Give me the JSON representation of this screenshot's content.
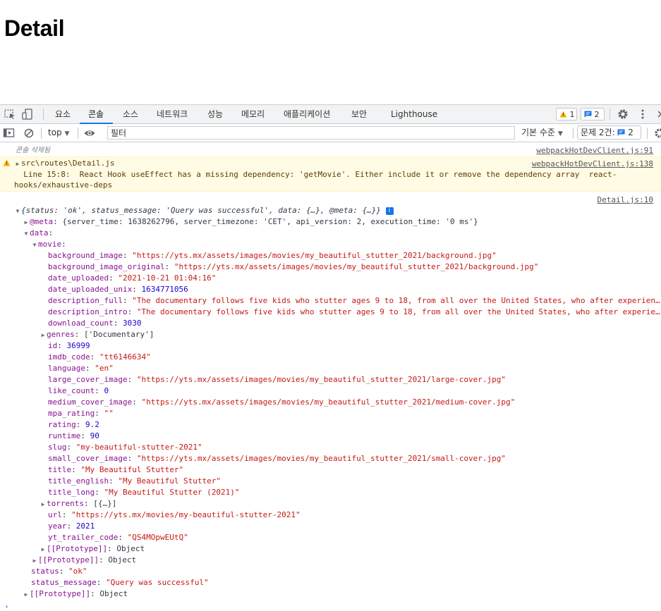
{
  "page": {
    "title": "Detail"
  },
  "devtools": {
    "tabs": [
      "요소",
      "콘솔",
      "소스",
      "네트워크",
      "성능",
      "메모리",
      "애플리케이션",
      "보안",
      "Lighthouse"
    ],
    "active_tab": "콘솔",
    "warnings_count": "1",
    "messages_count": "2",
    "filter": {
      "context": "top",
      "placeholder": "필터",
      "levels": "기본 수준",
      "issues_label": "문제 2건:",
      "issues_count": "2"
    }
  },
  "console": {
    "cleared_text": "콘솔 삭제됨",
    "cleared_source": "webpackHotDevClient.js:91",
    "warning": {
      "file": "src\\routes\\Detail.js",
      "source": "webpackHotDevClient.js:138",
      "line1": "  Line 15:8:  React Hook useEffect has a missing dependency: 'getMovie'. Either include it or remove the dependency array  react-",
      "line2": "hooks/exhaustive-deps"
    },
    "log_source": "Detail.js:10",
    "summary": "{status: 'ok', status_message: 'Query was successful', data: {…}, @meta: {…}}",
    "meta": {
      "key": "@meta",
      "value": "{server_time: 1638262796, server_timezone: 'CET', api_version: 2, execution_time: '0 ms'}"
    },
    "tree": [
      {
        "depth": 1,
        "arrow": "down",
        "key": "data",
        "value": "",
        "type": "plain"
      },
      {
        "depth": 2,
        "arrow": "down",
        "key": "movie",
        "value": "",
        "type": "plain"
      },
      {
        "depth": 3,
        "arrow": "",
        "key": "background_image",
        "value": "\"https://yts.mx/assets/images/movies/my_beautiful_stutter_2021/background.jpg\"",
        "type": "str"
      },
      {
        "depth": 3,
        "arrow": "",
        "key": "background_image_original",
        "value": "\"https://yts.mx/assets/images/movies/my_beautiful_stutter_2021/background.jpg\"",
        "type": "str"
      },
      {
        "depth": 3,
        "arrow": "",
        "key": "date_uploaded",
        "value": "\"2021-10-21 01:04:16\"",
        "type": "str"
      },
      {
        "depth": 3,
        "arrow": "",
        "key": "date_uploaded_unix",
        "value": "1634771056",
        "type": "num"
      },
      {
        "depth": 3,
        "arrow": "",
        "key": "description_full",
        "value": "\"The documentary follows five kids who stutter ages 9 to 18, from all over the United States, who after experien…",
        "type": "str"
      },
      {
        "depth": 3,
        "arrow": "",
        "key": "description_intro",
        "value": "\"The documentary follows five kids who stutter ages 9 to 18, from all over the United States, who after experie…",
        "type": "str"
      },
      {
        "depth": 3,
        "arrow": "",
        "key": "download_count",
        "value": "3030",
        "type": "num"
      },
      {
        "depth": 3,
        "arrow": "right",
        "key": "genres",
        "value": "['Documentary']",
        "type": "plain"
      },
      {
        "depth": 3,
        "arrow": "",
        "key": "id",
        "value": "36999",
        "type": "num"
      },
      {
        "depth": 3,
        "arrow": "",
        "key": "imdb_code",
        "value": "\"tt6146634\"",
        "type": "str"
      },
      {
        "depth": 3,
        "arrow": "",
        "key": "language",
        "value": "\"en\"",
        "type": "str"
      },
      {
        "depth": 3,
        "arrow": "",
        "key": "large_cover_image",
        "value": "\"https://yts.mx/assets/images/movies/my_beautiful_stutter_2021/large-cover.jpg\"",
        "type": "str"
      },
      {
        "depth": 3,
        "arrow": "",
        "key": "like_count",
        "value": "0",
        "type": "num"
      },
      {
        "depth": 3,
        "arrow": "",
        "key": "medium_cover_image",
        "value": "\"https://yts.mx/assets/images/movies/my_beautiful_stutter_2021/medium-cover.jpg\"",
        "type": "str"
      },
      {
        "depth": 3,
        "arrow": "",
        "key": "mpa_rating",
        "value": "\"\"",
        "type": "str"
      },
      {
        "depth": 3,
        "arrow": "",
        "key": "rating",
        "value": "9.2",
        "type": "num"
      },
      {
        "depth": 3,
        "arrow": "",
        "key": "runtime",
        "value": "90",
        "type": "num"
      },
      {
        "depth": 3,
        "arrow": "",
        "key": "slug",
        "value": "\"my-beautiful-stutter-2021\"",
        "type": "str"
      },
      {
        "depth": 3,
        "arrow": "",
        "key": "small_cover_image",
        "value": "\"https://yts.mx/assets/images/movies/my_beautiful_stutter_2021/small-cover.jpg\"",
        "type": "str"
      },
      {
        "depth": 3,
        "arrow": "",
        "key": "title",
        "value": "\"My Beautiful Stutter\"",
        "type": "str"
      },
      {
        "depth": 3,
        "arrow": "",
        "key": "title_english",
        "value": "\"My Beautiful Stutter\"",
        "type": "str"
      },
      {
        "depth": 3,
        "arrow": "",
        "key": "title_long",
        "value": "\"My Beautiful Stutter (2021)\"",
        "type": "str"
      },
      {
        "depth": 3,
        "arrow": "right",
        "key": "torrents",
        "value": "[{…}]",
        "type": "plain"
      },
      {
        "depth": 3,
        "arrow": "",
        "key": "url",
        "value": "\"https://yts.mx/movies/my-beautiful-stutter-2021\"",
        "type": "str"
      },
      {
        "depth": 3,
        "arrow": "",
        "key": "year",
        "value": "2021",
        "type": "num"
      },
      {
        "depth": 3,
        "arrow": "",
        "key": "yt_trailer_code",
        "value": "\"QS4MOpwEUtQ\"",
        "type": "str"
      },
      {
        "depth": 3,
        "arrow": "right",
        "key": "[[Prototype]]",
        "value": "Object",
        "type": "plain"
      },
      {
        "depth": 2,
        "arrow": "right",
        "key": "[[Prototype]]",
        "value": "Object",
        "type": "plain"
      },
      {
        "depth": 1,
        "arrow": "",
        "key": "status",
        "value": "\"ok\"",
        "type": "str"
      },
      {
        "depth": 1,
        "arrow": "",
        "key": "status_message",
        "value": "\"Query was successful\"",
        "type": "str"
      },
      {
        "depth": 1,
        "arrow": "right",
        "key": "[[Prototype]]",
        "value": "Object",
        "type": "plain"
      }
    ]
  }
}
